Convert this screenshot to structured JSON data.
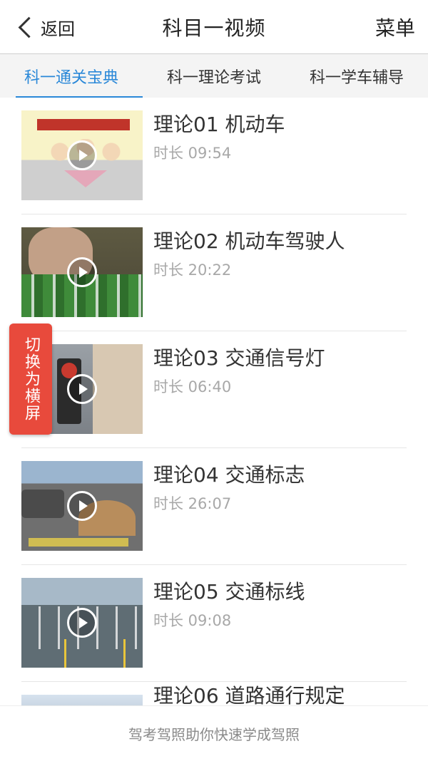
{
  "header": {
    "back_label": "返回",
    "title": "科目一视频",
    "menu_label": "菜单"
  },
  "tabs": [
    {
      "label": "科一通关宝典",
      "active": true
    },
    {
      "label": "科一理论考试",
      "active": false
    },
    {
      "label": "科一学车辅导",
      "active": false
    }
  ],
  "videos": [
    {
      "title": "理论01 机动车",
      "duration": "时长 09:54",
      "thumbnail": "cartoon-meeting"
    },
    {
      "title": "理论02 机动车驾驶人",
      "duration": "时长 20:22",
      "thumbnail": "man-with-bottles"
    },
    {
      "title": "理论03 交通信号灯",
      "duration": "时长 06:40",
      "thumbnail": "traffic-light"
    },
    {
      "title": "理论04 交通标志",
      "duration": "时长 26:07",
      "thumbnail": "road-construction"
    },
    {
      "title": "理论05 交通标线",
      "duration": "时长 09:08",
      "thumbnail": "lane-markings"
    },
    {
      "title": "理论06 道路通行规定",
      "duration": "",
      "thumbnail": "road"
    }
  ],
  "float_button": {
    "label": "切换为横屏"
  },
  "footer": {
    "text": "驾考驾照助你快速学成驾照"
  },
  "colors": {
    "accent": "#2a88d8",
    "float_bg": "#e84a3c"
  },
  "icons": {
    "back": "chevron-left-icon",
    "play": "play-circle-icon"
  }
}
